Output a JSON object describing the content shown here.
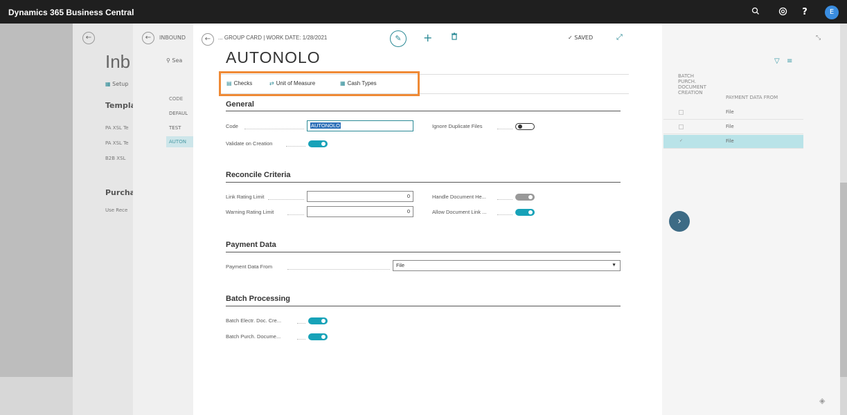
{
  "app": {
    "title": "Dynamics 365 Business Central",
    "avatar_initial": "E"
  },
  "topbar_icons": [
    "search-icon",
    "settings-icon",
    "help-icon"
  ],
  "background_page1": {
    "title": "Inb",
    "setup_action": "Setup",
    "templates_heading": "Templa",
    "template_items": [
      "PA XSL Te",
      "PA XSL Te",
      "B2B XSL"
    ],
    "purchase_heading": "Purcha",
    "purchase_item": "Use Rece"
  },
  "background_page2": {
    "title": "INBOUND",
    "search_placeholder": "Sea",
    "code_header": "CODE",
    "rows": [
      "DEFAUL",
      "TEST",
      "AUTON"
    ]
  },
  "right_list": {
    "batch_header": [
      "BATCH",
      "PURCH.",
      "DOCUMENT",
      "CREATION"
    ],
    "payment_header": "PAYMENT DATA FROM",
    "rows": [
      {
        "batch": "",
        "payment": "File"
      },
      {
        "batch": "",
        "payment": "File"
      },
      {
        "batch": "✓",
        "payment": "File"
      }
    ]
  },
  "card": {
    "breadcrumb": "... GROUP CARD | WORK DATE: 1/28/2021",
    "status": "SAVED",
    "title": "AUTONOLO",
    "actions": [
      {
        "label": "Checks",
        "icon": "checks-icon"
      },
      {
        "label": "Unit of Measure",
        "icon": "unit-of-measure-icon"
      },
      {
        "label": "Cash Types",
        "icon": "cash-types-icon"
      }
    ],
    "general": {
      "heading": "General",
      "code_label": "Code",
      "code_value": "AUTONOLO",
      "validate_label": "Validate on Creation",
      "validate_on": true,
      "ignore_dup_label": "Ignore Duplicate Files",
      "ignore_dup_on": false
    },
    "reconcile": {
      "heading": "Reconcile Criteria",
      "link_label": "Link Rating Limit",
      "link_value": "0",
      "warning_label": "Warning Rating Limit",
      "warning_value": "0",
      "handle_label": "Handle Document He...",
      "allow_label": "Allow Document Link ..."
    },
    "payment": {
      "heading": "Payment Data",
      "from_label": "Payment Data From",
      "from_value": "File"
    },
    "batch": {
      "heading": "Batch Processing",
      "electr_label": "Batch Electr. Doc. Cre...",
      "purch_label": "Batch Purch. Docume..."
    }
  }
}
